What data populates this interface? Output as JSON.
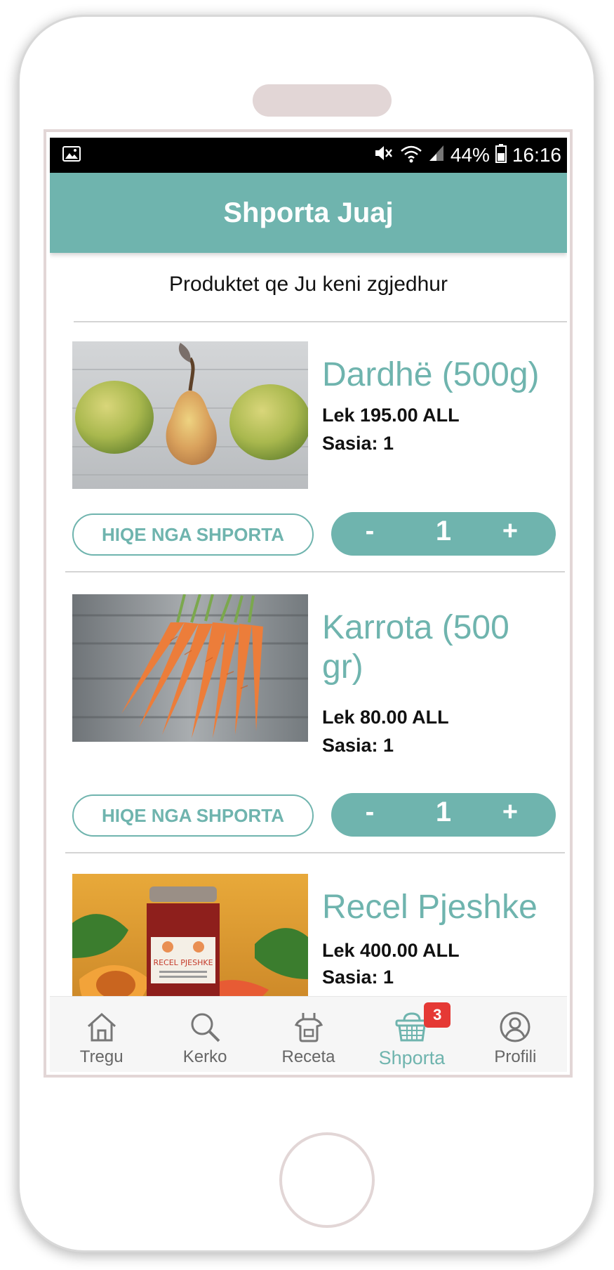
{
  "status_bar": {
    "battery": "44%",
    "time": "16:16"
  },
  "app_bar": {
    "title": "Shporta Juaj"
  },
  "subtitle": "Produktet qe Ju keni zgjedhur",
  "cart_items": [
    {
      "name": "Dardhë (500g)",
      "price": "Lek 195.00 ALL",
      "quantity_label": "Sasia: 1",
      "quantity": "1",
      "remove_label": "HIQE NGA SHPORTA",
      "minus": "-",
      "plus": "+",
      "image": "pears"
    },
    {
      "name": "Karrota (500 gr)",
      "price": "Lek 80.00 ALL",
      "quantity_label": "Sasia: 1",
      "quantity": "1",
      "remove_label": "HIQE NGA SHPORTA",
      "minus": "-",
      "plus": "+",
      "image": "carrots"
    },
    {
      "name": "Recel Pjeshke",
      "price": "Lek 400.00 ALL",
      "quantity_label": "Sasia: 1",
      "image": "peach-jam",
      "jar_label": "RECEL PJESHKE"
    }
  ],
  "bottom_nav": {
    "items": [
      {
        "label": "Tregu",
        "icon": "home-icon"
      },
      {
        "label": "Kerko",
        "icon": "search-icon"
      },
      {
        "label": "Receta",
        "icon": "apron-icon"
      },
      {
        "label": "Shporta",
        "icon": "basket-icon",
        "badge": "3",
        "active": true
      },
      {
        "label": "Profili",
        "icon": "profile-icon"
      }
    ]
  },
  "colors": {
    "accent": "#6fb4ae",
    "badge": "#e53935",
    "status_bar": "#000000"
  }
}
